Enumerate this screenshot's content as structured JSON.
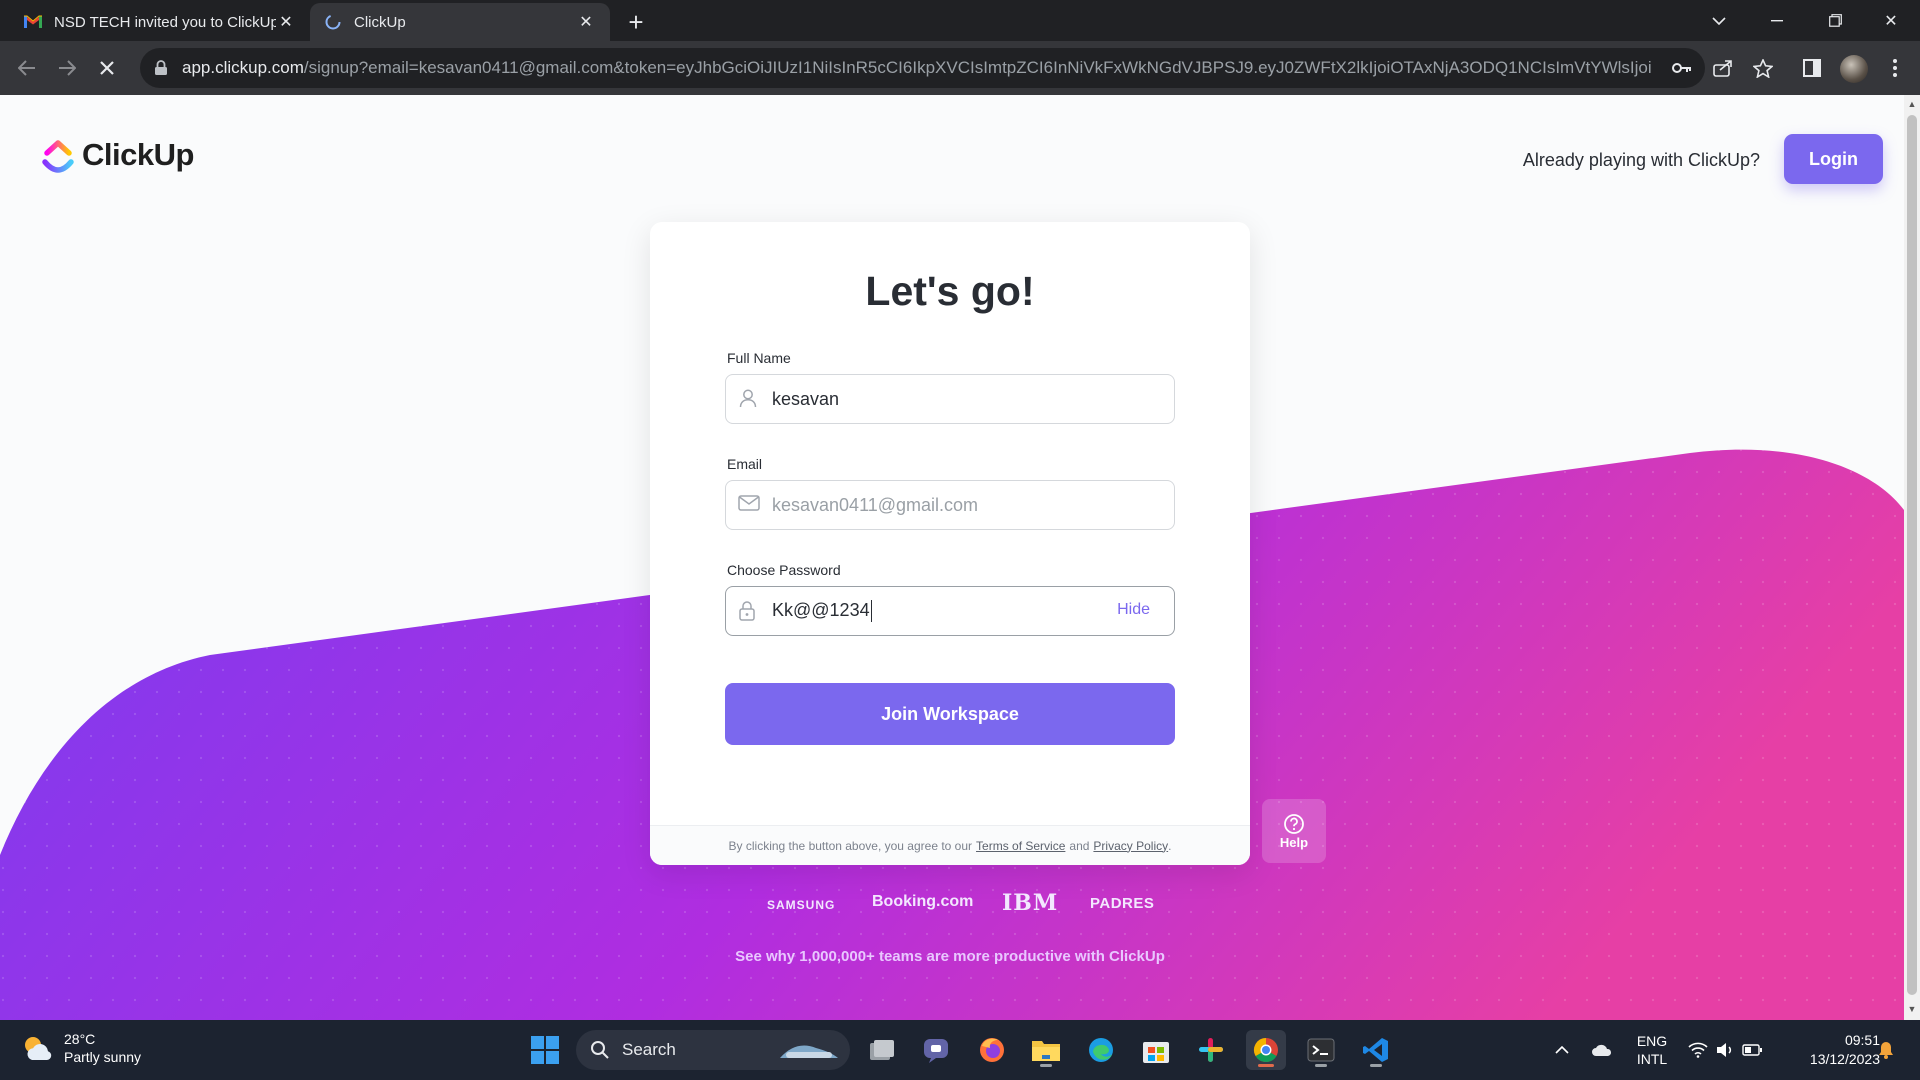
{
  "browser": {
    "tabs": [
      {
        "title": "NSD TECH invited you to ClickUp",
        "favicon": "gmail-icon"
      },
      {
        "title": "ClickUp",
        "favicon": "clickup-loading-icon"
      }
    ],
    "url_host": "app.clickup.com",
    "url_rest": "/signup?email=kesavan0411@gmail.com&token=eyJhbGciOiJIUzI1NiIsInR5cCI6IkpXVCIsImtpZCI6InNiVkFxWkNGdVJBPSJ9.eyJ0ZWFtX2lkIjoiOTAxNjA3ODQ1NCIsImVtYWlsIjoia..."
  },
  "header": {
    "logo_text": "ClickUp",
    "already_text": "Already playing with ClickUp?",
    "login_label": "Login"
  },
  "form": {
    "title": "Let's go!",
    "full_name_label": "Full Name",
    "full_name_value": "kesavan",
    "email_label": "Email",
    "email_value": "kesavan0411@gmail.com",
    "password_label": "Choose Password",
    "password_value": "Kk@@1234",
    "hide_label": "Hide",
    "submit_label": "Join Workspace",
    "terms_prefix": "By clicking the button above, you agree to our",
    "terms_link": "Terms of Service",
    "terms_and": "and",
    "privacy_link": "Privacy Policy",
    "terms_suffix": "."
  },
  "help_label": "Help",
  "brands": [
    "SAMSUNG",
    "Booking.com",
    "IBM",
    "PADRES"
  ],
  "tagline": "See why 1,000,000+ teams are more productive with ClickUp",
  "taskbar": {
    "weather_temp": "28°C",
    "weather_desc": "Partly sunny",
    "search_label": "Search",
    "lang_top": "ENG",
    "lang_bottom": "INTL",
    "time": "09:51",
    "date": "13/12/2023"
  },
  "colors": {
    "accent": "#7b68ee",
    "wave_start": "#7a3cf0",
    "wave_mid": "#b02de0",
    "wave_end": "#e63fa5"
  }
}
